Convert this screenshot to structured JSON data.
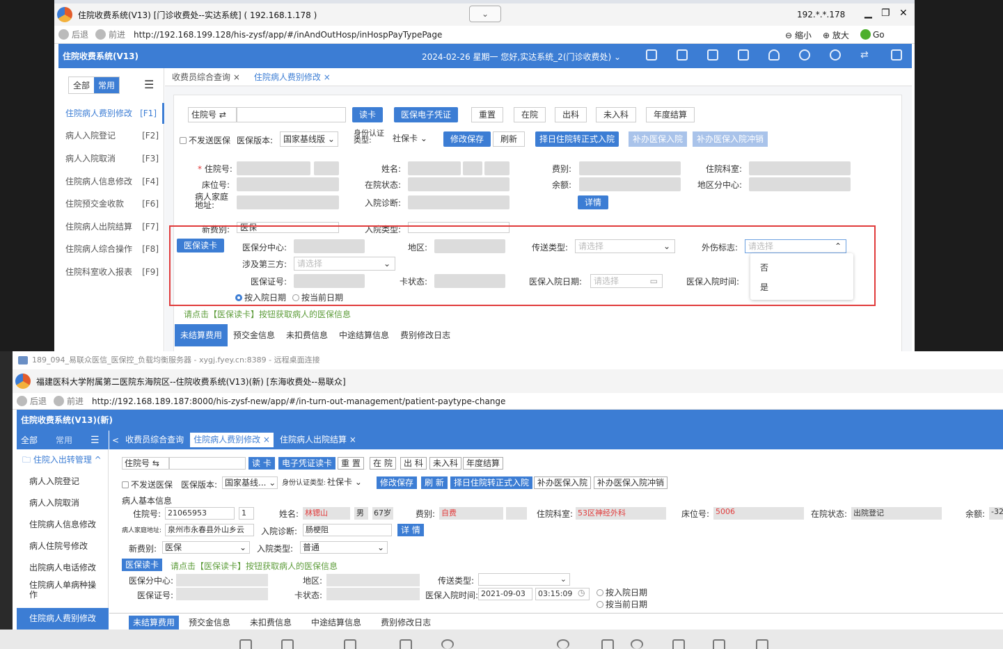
{
  "win1": {
    "title": "住院收费系统(V13) [门诊收费处--实达系统] ( 192.168.1.178 )",
    "ip": "192.*.*.178",
    "back": "后退",
    "forward": "前进",
    "url": "http://192.168.199.128/his-zysf/app/#/inAndOutHosp/inHospPayTypePage",
    "zoom_out": "缩小",
    "zoom_in": "放大",
    "go": "Go",
    "app_name": "住院收费系统(V13)",
    "date_user": "2024-02-26 星期一   您好,实达系统_2(门诊收费处) ⌄",
    "tab_all": "全部",
    "tab_common": "常用",
    "sidebar": [
      {
        "label": "住院病人费别修改",
        "key": "[F1]"
      },
      {
        "label": "病人入院登记",
        "key": "[F2]"
      },
      {
        "label": "病人入院取消",
        "key": "[F3]"
      },
      {
        "label": "住院病人信息修改",
        "key": "[F4]"
      },
      {
        "label": "住院预交金收款",
        "key": "[F6]"
      },
      {
        "label": "住院病人出院结算",
        "key": "[F7]"
      },
      {
        "label": "住院病人综合操作",
        "key": "[F8]"
      },
      {
        "label": "住院科室收入报表",
        "key": "[F9]"
      }
    ],
    "tabs": [
      "收费员综合查询 ×",
      "住院病人费别修改 ×"
    ],
    "toolbar": {
      "hosp_no": "住院号",
      "read_card": "读卡",
      "e_voucher": "医保电子凭证",
      "reset": "重置",
      "in_hosp": "在院",
      "discharge": "出科",
      "not_admitted": "未入科",
      "annual": "年度结算"
    },
    "row2": {
      "not_send": "不发送医保",
      "version_label": "医保版本:",
      "version_value": "国家基线版",
      "id_auth": "身份认证类型:",
      "id_value": "社保卡",
      "save": "修改保存",
      "refresh": "刷新",
      "admit": "择日住院转正式入院",
      "supp_admit": "补办医保入院",
      "supp_cancel": "补办医保入院冲销"
    },
    "labels": {
      "hosp_no": "住院号:",
      "name": "姓名:",
      "fee_type": "费别:",
      "dept": "住院科室:",
      "bed": "床位号:",
      "status": "在院状态:",
      "balance": "余额:",
      "region": "地区分中心:",
      "address": "病人家庭地址:",
      "diagnosis": "入院诊断:",
      "detail": "详情",
      "new_fee": "新费别:",
      "new_fee_value": "医保",
      "admit_type": "入院类型:"
    },
    "ins": {
      "read": "医保读卡",
      "center": "医保分中心:",
      "area": "地区:",
      "send_type": "传送类型:",
      "placeholder": "请选择",
      "injury": "外伤标志:",
      "third": "涉及第三方:",
      "ins_no": "医保证号:",
      "card_status": "卡状态:",
      "adm_date": "医保入院日期:",
      "adm_time": "医保入院时间:",
      "by_adm": "按入院日期",
      "by_now": "按当前日期",
      "hint": "请点击【医保读卡】按钮获取病人的医保信息"
    },
    "dropdown": [
      "否",
      "是"
    ],
    "subtabs": [
      "未结算费用",
      "预交金信息",
      "未扣费信息",
      "中途结算信息",
      "费别修改日志"
    ]
  },
  "win2": {
    "remote": "189_094_易联众医信_医保控_负载均衡服务器 - xygj.fyey.cn:8389 - 远程桌面连接",
    "title": "福建医科大学附属第二医院东海院区--住院收费系统(V13)(新) [东海收费处--易联众]",
    "back": "后退",
    "forward": "前进",
    "url": "http://192.168.189.187:8000/his-zysf-new/app/#/in-turn-out-management/patient-paytype-change",
    "app_name": "住院收费系统(V13)(新)",
    "tab_all": "全部",
    "tab_common": "常用",
    "group": "住院入出转管理 ^",
    "sidebar": [
      "病人入院登记",
      "病人入院取消",
      "住院病人信息修改",
      "病人住院号修改",
      "出院病人电话修改",
      "住院病人单病种操作",
      "住院病人费别修改"
    ],
    "tabs": [
      "收费员综合查询",
      "住院病人费别修改 ×",
      "住院病人出院结算 ×"
    ],
    "toolbar": {
      "hosp_no": "住院号 ⇆",
      "read": "读 卡",
      "e_read": "电子凭证读卡",
      "reset": "重 置",
      "in_hosp": "在 院",
      "discharge": "出 科",
      "not_admitted": "未入科",
      "annual": "年度结算"
    },
    "row2": {
      "not_send": "不发送医保",
      "version_label": "医保版本:",
      "version_value": "国家基线",
      "id_auth": "身份认证类型:",
      "id_value": "社保卡",
      "save": "修改保存",
      "refresh": "刷 新",
      "admit": "择日住院转正式入院",
      "supp_admit": "补办医保入院",
      "supp_cancel": "补办医保入院冲销"
    },
    "basic": "病人基本信息",
    "patient": {
      "hosp_no_label": "住院号:",
      "hosp_no": "21065953",
      "times": "1",
      "name_label": "姓名:",
      "name": "林锶山",
      "sex": "男",
      "age": "67岁",
      "fee_label": "费别:",
      "fee": "自费",
      "dept_label": "住院科室:",
      "dept": "53区神经外科",
      "bed_label": "床位号:",
      "bed": "5006",
      "status_label": "在院状态:",
      "status": "出院登记",
      "balance_label": "余额:",
      "balance": "-32",
      "addr_label": "病人家庭地址:",
      "addr": "泉州市永春县外山乡云",
      "diag_label": "入院诊断:",
      "diag": "肠梗阻",
      "detail": "详 情",
      "new_fee_label": "新费别:",
      "new_fee": "医保",
      "adm_type_label": "入院类型:",
      "adm_type": "普通"
    },
    "ins": {
      "read": "医保读卡",
      "hint": "请点击【医保读卡】按钮获取病人的医保信息",
      "center": "医保分中心:",
      "area": "地区:",
      "send_type": "传送类型:",
      "ins_no": "医保证号:",
      "card_status": "卡状态:",
      "adm_time": "医保入院时间:",
      "date": "2021-09-03",
      "time": "03:15:09",
      "by_adm": "按入院日期",
      "by_now": "按当前日期"
    },
    "subtabs": [
      "未结算费用",
      "预交金信息",
      "未扣费信息",
      "中途结算信息",
      "费别修改日志"
    ]
  }
}
